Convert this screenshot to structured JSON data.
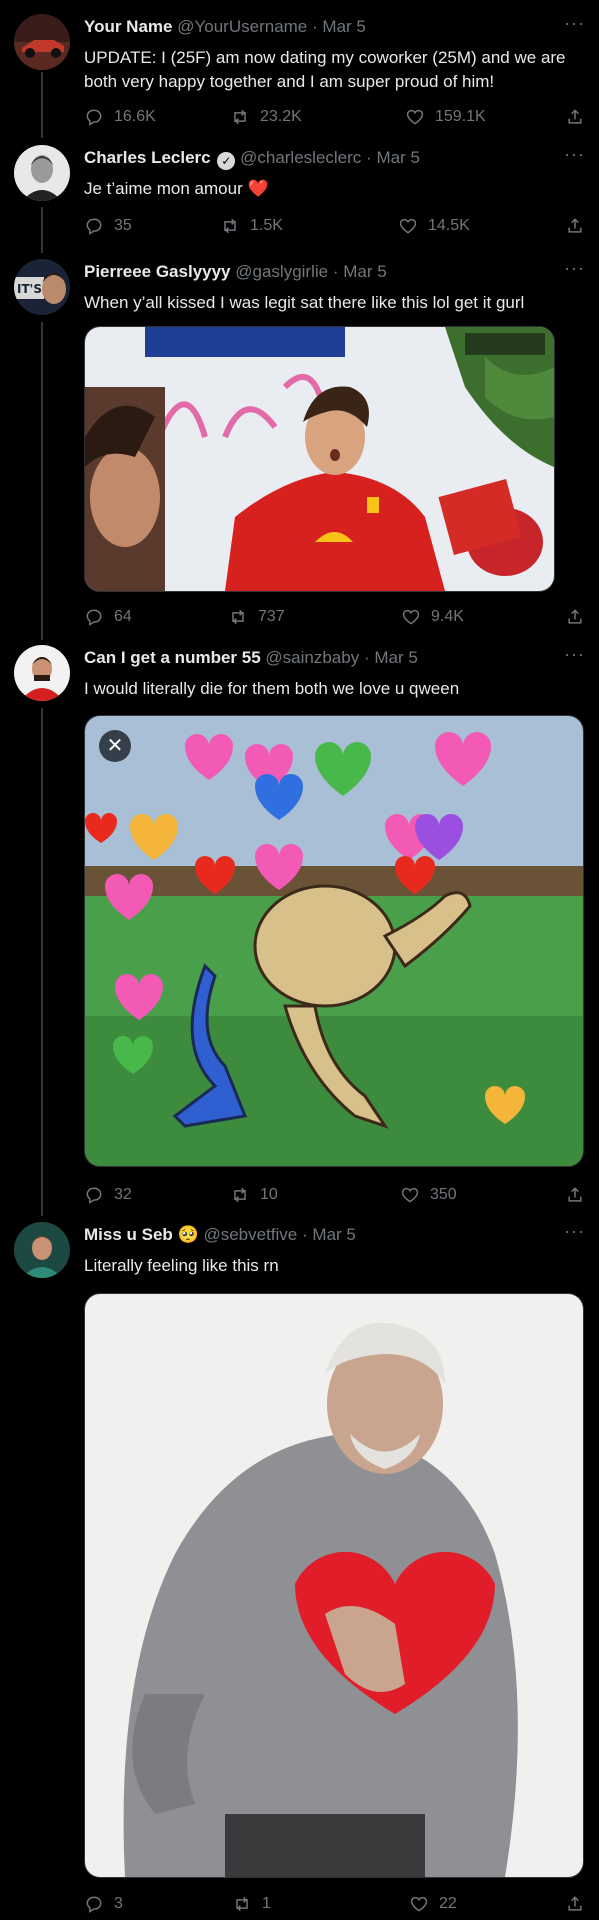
{
  "tweets": [
    {
      "name": "Your Name",
      "handle": "@YourUsername",
      "date": "Mar 5",
      "text": "UPDATE: I (25F) am now dating my coworker (25M) and we are both very happy together and I am super proud of him!",
      "replies": "16.6K",
      "retweets": "23.2K",
      "likes": "159.1K"
    },
    {
      "name": "Charles Leclerc",
      "handle": "@charlesleclerc",
      "date": "Mar 5",
      "text": "Je t’aime mon amour",
      "emoji": "❤️",
      "replies": "35",
      "retweets": "1.5K",
      "likes": "14.5K"
    },
    {
      "name": "Pierreee Gaslyyyy",
      "handle": "@gaslygirlie",
      "date": "Mar 5",
      "text": "When y’all kissed I was legit sat there like this lol get it gurl",
      "media_overlay": "RED",
      "replies": "64",
      "retweets": "737",
      "likes": "9.4K"
    },
    {
      "name": "Can I get a number 55",
      "handle": "@sainzbaby",
      "date": "Mar 5",
      "text": "I would literally die for them both we love u qween",
      "replies": "32",
      "retweets": "10",
      "likes": "350"
    },
    {
      "name": "Miss u Seb",
      "name_emoji": "🥺",
      "handle": "@sebvetfive",
      "date": "Mar 5",
      "text": "Literally feeling like this rn",
      "replies": "3",
      "retweets": "1",
      "likes": "22"
    }
  ],
  "ui": {
    "separator": "·",
    "more": "···",
    "verified_mark": "✓",
    "close_glyph": "✕"
  },
  "colors": {
    "background": "#000000",
    "text": "#e7e9ea",
    "secondary": "#71767b",
    "thread_line": "#333639",
    "like_red": "#f4212e"
  }
}
